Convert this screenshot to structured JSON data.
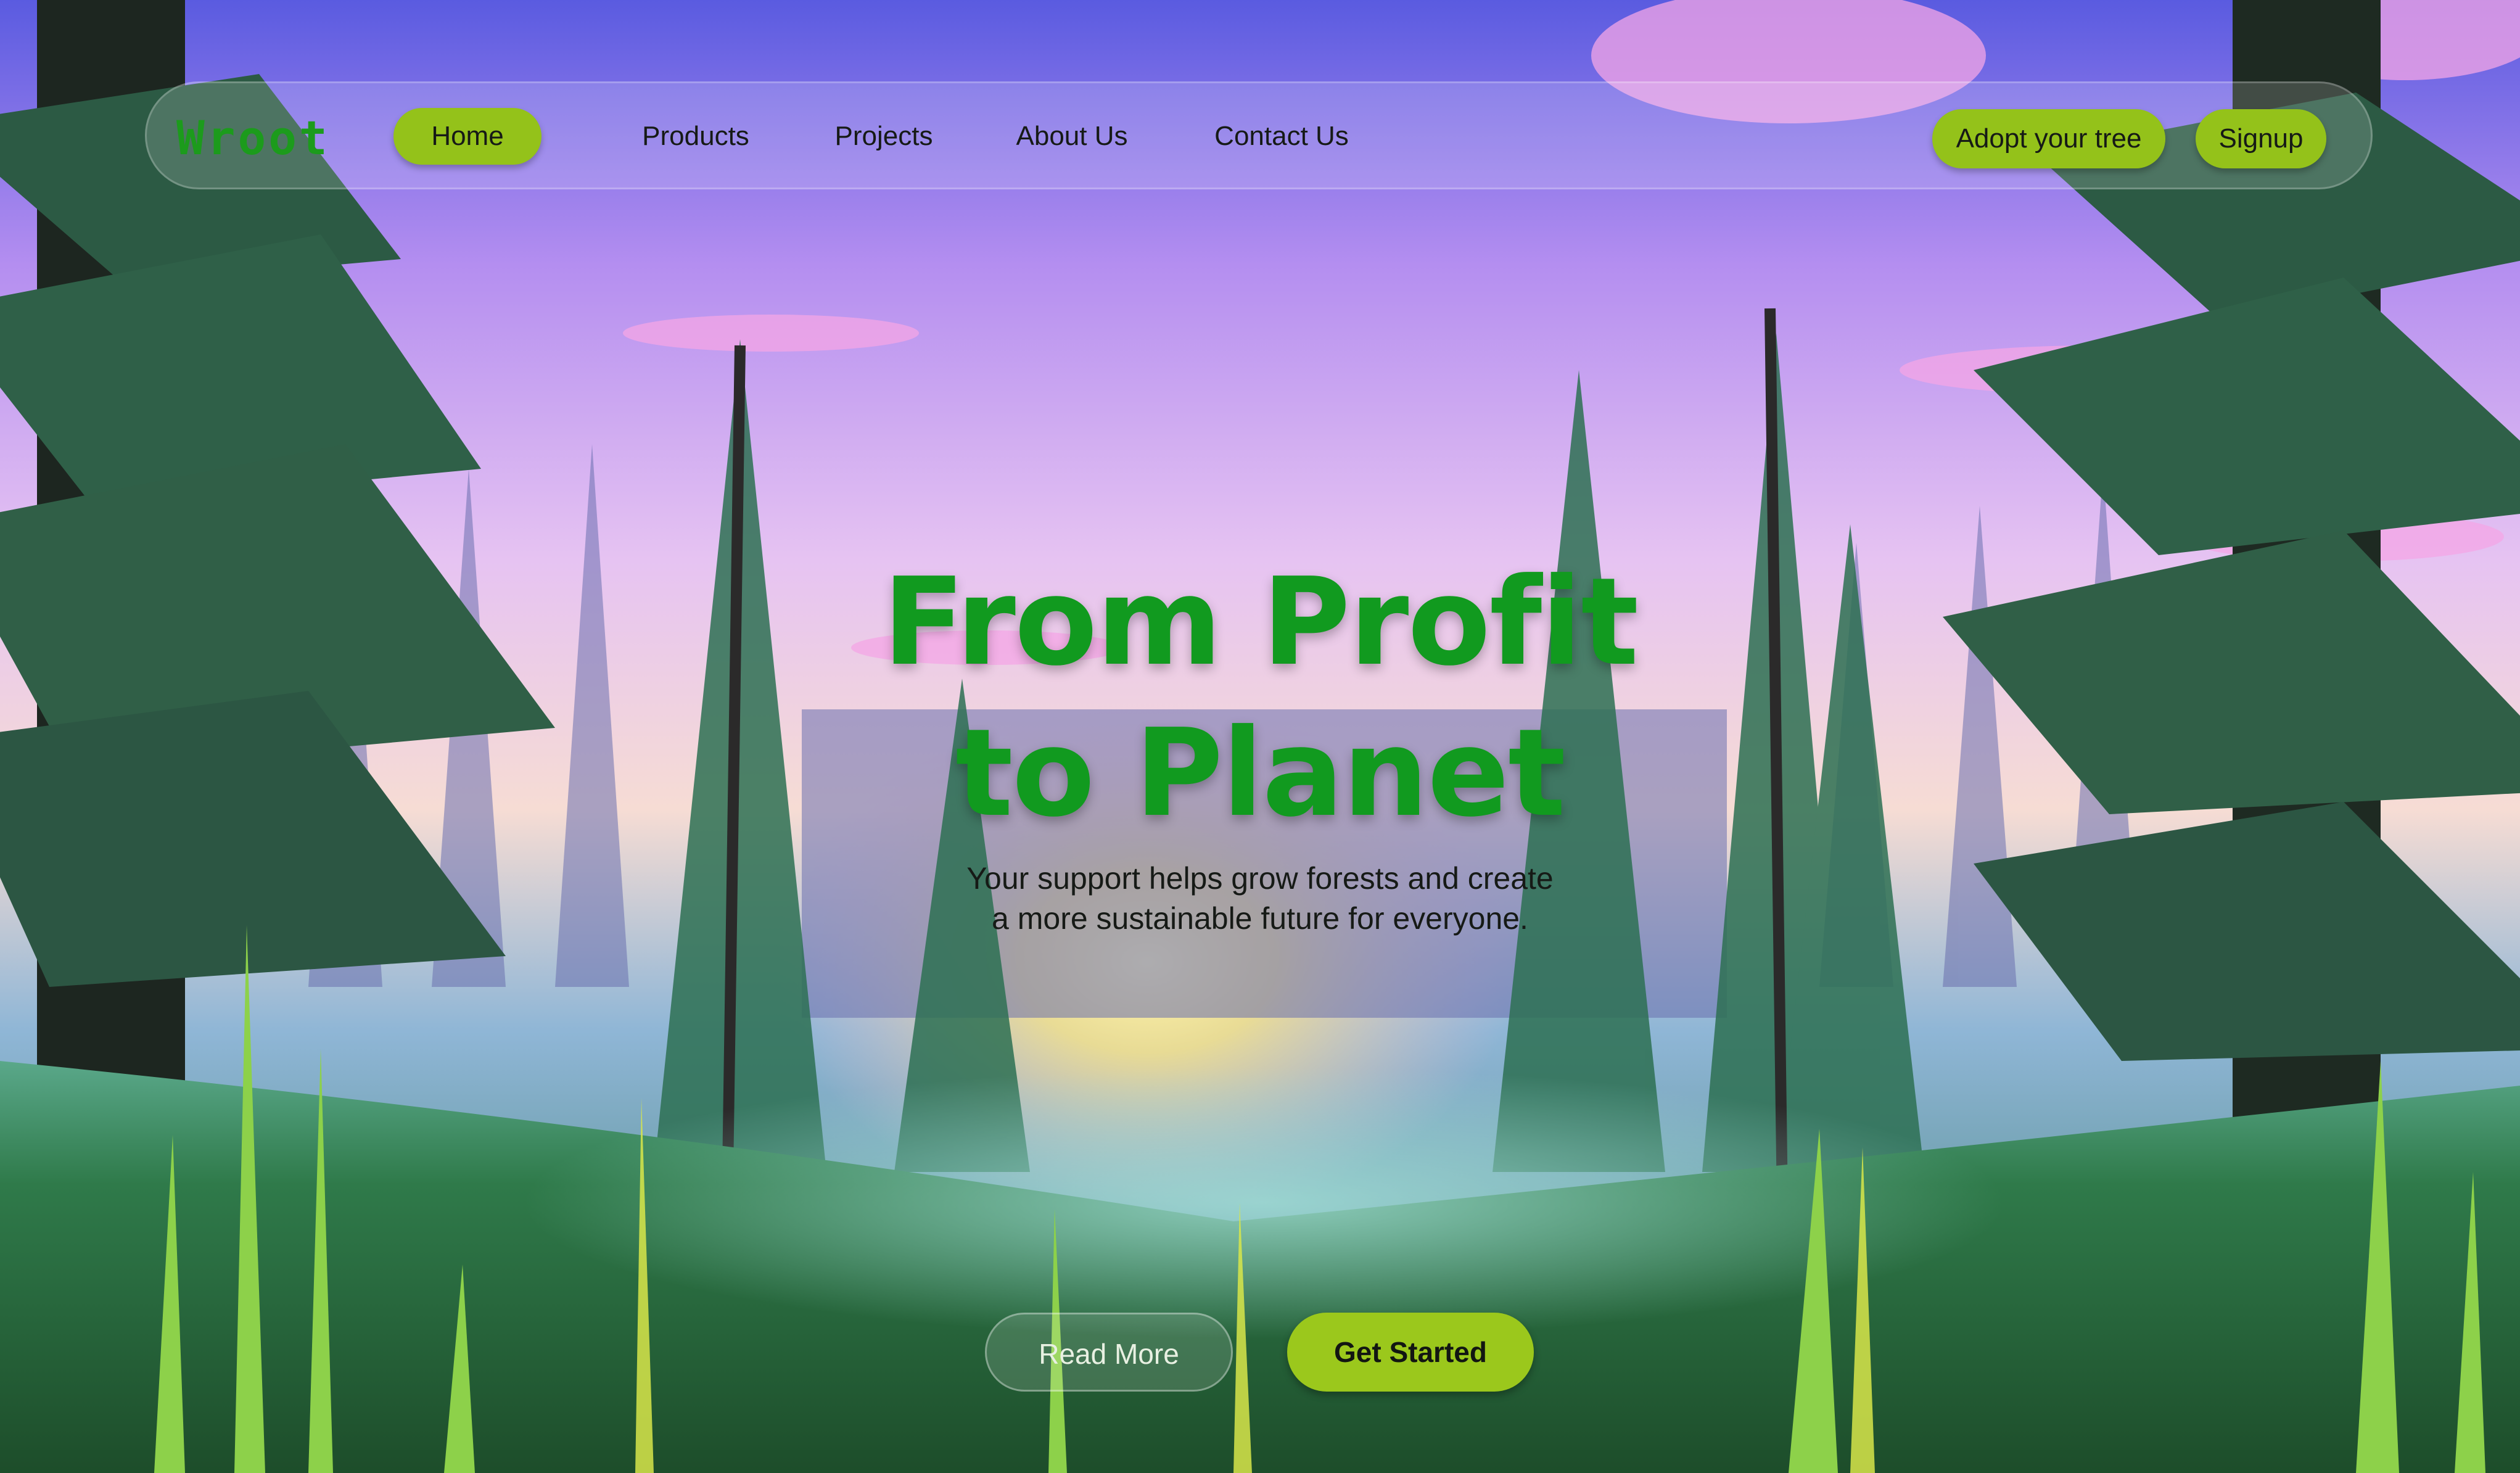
{
  "navbar": {
    "logo": "Wroot",
    "items": [
      {
        "label": "Home"
      },
      {
        "label": "Products"
      },
      {
        "label": "Projects"
      },
      {
        "label": "About Us"
      },
      {
        "label": "Contact Us"
      }
    ],
    "adopt_label": "Adopt your tree",
    "signup_label": "Signup"
  },
  "hero": {
    "title_line1": "From Profit",
    "title_line2": "to Planet",
    "subtitle_line1": "Your support helps grow forests and create",
    "subtitle_line2": "a more sustainable future for everyone.",
    "read_more_label": "Read More",
    "get_started_label": "Get Started"
  },
  "colors": {
    "accent": "#94c21a",
    "brand_green": "#119a1f",
    "sky_top": "#5a5fd8",
    "sky_glow": "#fbeaa0",
    "forest_dark": "#1e4a33"
  }
}
